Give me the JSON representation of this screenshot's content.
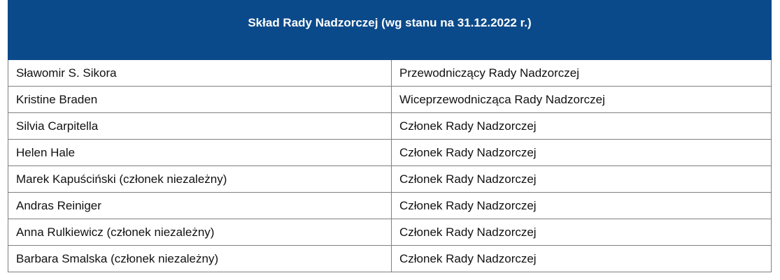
{
  "table": {
    "title": "Skład Rady Nadzorczej (wg stanu na 31.12.2022 r.)",
    "header_color": "#0b4a8a",
    "rows": [
      {
        "name": "Sławomir S. Sikora",
        "role": "Przewodniczący Rady Nadzorczej"
      },
      {
        "name": "Kristine Braden",
        "role": "Wiceprzewodnicząca Rady Nadzorczej"
      },
      {
        "name": "Silvia Carpitella",
        "role": "Członek Rady Nadzorczej"
      },
      {
        "name": "Helen Hale",
        "role": "Członek Rady Nadzorczej"
      },
      {
        "name": "Marek Kapuściński (członek niezależny)",
        "role": "Członek Rady Nadzorczej"
      },
      {
        "name": "Andras Reiniger",
        "role": "Członek Rady Nadzorczej"
      },
      {
        "name": "Anna Rulkiewicz (członek niezależny)",
        "role": "Członek Rady Nadzorczej"
      },
      {
        "name": "Barbara Smalska (członek niezależny)",
        "role": "Członek Rady Nadzorczej"
      }
    ]
  }
}
